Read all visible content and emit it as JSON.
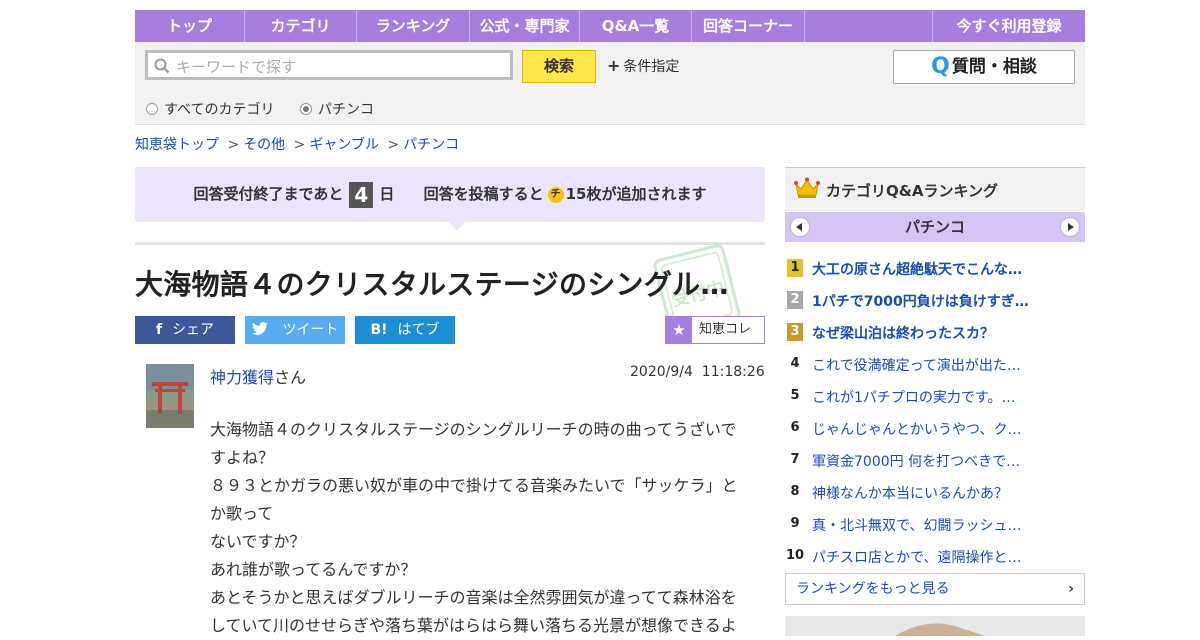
{
  "nav": {
    "items": [
      "トップ",
      "カテゴリ",
      "ランキング",
      "公式・専門家",
      "Q&A一覧",
      "回答コーナー",
      "",
      "今すぐ利用登録"
    ]
  },
  "search": {
    "placeholder": "キーワードで探す",
    "value": "",
    "button_label": "検索",
    "condition_label": "条件指定",
    "ask_button_label": "質問・相談",
    "scope_all": "すべてのカテゴリ",
    "scope_current": "パチンコ",
    "selected_scope": "パチンコ"
  },
  "breadcrumb": {
    "items": [
      "知恵袋トップ",
      "その他",
      "ギャンブル",
      "パチンコ"
    ],
    "separator": ">"
  },
  "notice": {
    "prefix": "回答受付終了まであと",
    "days": "4",
    "days_unit": "日",
    "middle": "回答を投稿すると",
    "coin_glyph": "チ",
    "suffix": "15枚が追加されます"
  },
  "question": {
    "title": "大海物語４のクリスタルステージのシングル…",
    "stamp_text": "受付中",
    "share": {
      "facebook": "シェア",
      "twitter": "ツイート",
      "hatebu_glyph": "B!",
      "hatebu": "はてブ"
    },
    "collect_label": "知恵コレ",
    "user_name": "神力獲得",
    "user_suffix": "さん",
    "date": "2020/9/4",
    "time": "11:18:26",
    "body_lines": [
      "大海物語４のクリスタルステージのシングルリーチの時の曲ってうざいで",
      "すよね？",
      "８９３とかガラの悪い奴が車の中で掛けてる音楽みたいで「サッケラ」と",
      "か歌って",
      "ないですか？",
      "あれ誰が歌ってるんですか？",
      "あとそうかと思えばダブルリーチの音楽は全然雰囲気が違ってて森林浴を",
      "していて川のせせらぎや落ち葉がはらはら舞い落ちる光景が想像できるよ"
    ]
  },
  "ranking": {
    "header": "カテゴリQ&Aランキング",
    "category": "パチンコ",
    "items": [
      {
        "rank": "1",
        "text": "大工の原さん超絶駄天でこんな…"
      },
      {
        "rank": "2",
        "text": "1パチで7000円負けは負けすぎ…"
      },
      {
        "rank": "3",
        "text": "なぜ梁山泊は終わったスカ？"
      },
      {
        "rank": "4",
        "text": "これで役満確定って演出が出た…"
      },
      {
        "rank": "5",
        "text": "これが1パチプロの実力です。…"
      },
      {
        "rank": "6",
        "text": "じゃんじゃんとかいうやつ、ク…"
      },
      {
        "rank": "7",
        "text": "軍資金7000円 何を打つべきで…"
      },
      {
        "rank": "8",
        "text": "神様なんか本当にいるんかあ？"
      },
      {
        "rank": "9",
        "text": "真・北斗無双で、幻闘ラッシュ…"
      },
      {
        "rank": "10",
        "text": "パチスロ店とかで、遠隔操作と…"
      }
    ],
    "more_label": "ランキングをもっと見る"
  },
  "colors": {
    "nav_purple": "#a67fde",
    "search_button_yellow": "#fde54a",
    "link_blue": "#1a4bb3",
    "notice_bg": "#ece4fb",
    "facebook": "#3b5998",
    "twitter": "#55acee",
    "hatebu": "#1b8fd6"
  },
  "icons": {
    "search": "search-icon",
    "question": "q-icon",
    "crown": "crown-icon",
    "star": "star-icon"
  }
}
